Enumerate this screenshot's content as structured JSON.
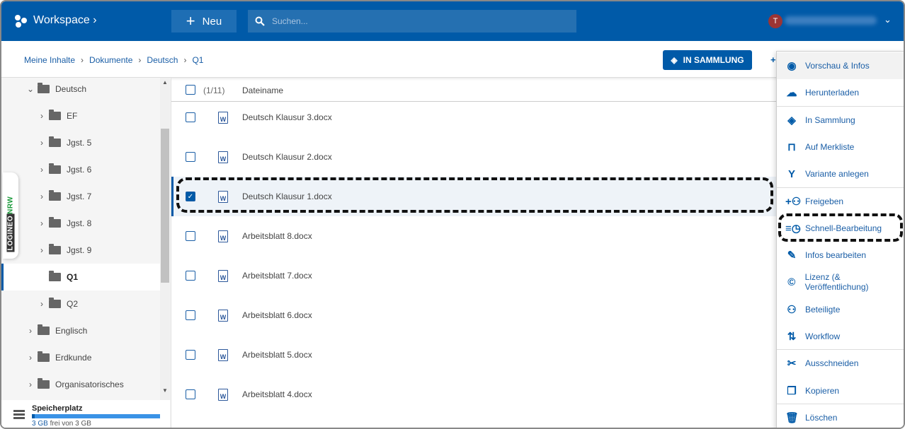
{
  "header": {
    "app_title": "Workspace",
    "new_label": "Neu",
    "search_placeholder": "Suchen...",
    "avatar_initial": "T",
    "brand_color": "#005aa8"
  },
  "breadcrumb": [
    "Meine Inhalte",
    "Dokumente",
    "Deutsch",
    "Q1"
  ],
  "toolbar": {
    "collection_button": "IN SAMMLUNG"
  },
  "sidebar": {
    "tree": [
      {
        "label": "Deutsch",
        "level": 1,
        "state": "expanded"
      },
      {
        "label": "EF",
        "level": 2,
        "state": "collapsed"
      },
      {
        "label": "Jgst. 5",
        "level": 2,
        "state": "collapsed"
      },
      {
        "label": "Jgst. 6",
        "level": 2,
        "state": "collapsed"
      },
      {
        "label": "Jgst. 7",
        "level": 2,
        "state": "collapsed"
      },
      {
        "label": "Jgst. 8",
        "level": 2,
        "state": "collapsed"
      },
      {
        "label": "Jgst. 9",
        "level": 2,
        "state": "collapsed"
      },
      {
        "label": "Q1",
        "level": 2,
        "state": "leaf",
        "selected": true
      },
      {
        "label": "Q2",
        "level": 2,
        "state": "collapsed"
      },
      {
        "label": "Englisch",
        "level": 1,
        "state": "collapsed"
      },
      {
        "label": "Erdkunde",
        "level": 1,
        "state": "collapsed"
      },
      {
        "label": "Organisatorisches",
        "level": 1,
        "state": "collapsed"
      }
    ],
    "storage": {
      "label": "Speicherplatz",
      "free": "3 GB",
      "text": "frei von 3 GB",
      "used_fraction": 0.02
    },
    "logineo": {
      "part1": "LOGINEO",
      "part2": "NRW"
    }
  },
  "filelist": {
    "count": "(1/11)",
    "column_name": "Dateiname",
    "files": [
      {
        "name": "Deutsch Klausur 3.docx",
        "checked": false
      },
      {
        "name": "Deutsch Klausur 2.docx",
        "checked": false
      },
      {
        "name": "Deutsch Klausur 1.docx",
        "checked": true
      },
      {
        "name": "Arbeitsblatt 8.docx",
        "checked": false
      },
      {
        "name": "Arbeitsblatt 7.docx",
        "checked": false
      },
      {
        "name": "Arbeitsblatt 6.docx",
        "checked": false
      },
      {
        "name": "Arbeitsblatt 5.docx",
        "checked": false
      },
      {
        "name": "Arbeitsblatt 4.docx",
        "checked": false
      }
    ]
  },
  "context_menu": [
    {
      "label": "Vorschau & Infos",
      "icon": "eye-icon",
      "glyph": "◉"
    },
    {
      "label": "Herunterladen",
      "icon": "cloud-download-icon",
      "glyph": "☁",
      "divider_after": true
    },
    {
      "label": "In Sammlung",
      "icon": "layers-icon",
      "glyph": "◈"
    },
    {
      "label": "Auf Merkliste",
      "icon": "bookmark-icon",
      "glyph": "⊓"
    },
    {
      "label": "Variante anlegen",
      "icon": "fork-icon",
      "glyph": "Y",
      "divider_after": true
    },
    {
      "label": "Freigeben",
      "icon": "share-people-icon",
      "glyph": "+⚇"
    },
    {
      "label": "Schnell-Bearbeitung",
      "icon": "quick-edit-clock-icon",
      "glyph": "≡◷"
    },
    {
      "label": "Infos bearbeiten",
      "icon": "pencil-icon",
      "glyph": "✎"
    },
    {
      "label": "Lizenz (& Veröffentlichung)",
      "icon": "copyright-icon",
      "glyph": "©"
    },
    {
      "label": "Beteiligte",
      "icon": "people-icon",
      "glyph": "⚇"
    },
    {
      "label": "Workflow",
      "icon": "workflow-arrows-icon",
      "glyph": "⇅",
      "divider_after": true
    },
    {
      "label": "Ausschneiden",
      "icon": "scissors-icon",
      "glyph": "✂"
    },
    {
      "label": "Kopieren",
      "icon": "copy-icon",
      "glyph": "❐",
      "divider_after": true
    },
    {
      "label": "Löschen",
      "icon": "trash-icon",
      "glyph": "🗑"
    }
  ]
}
